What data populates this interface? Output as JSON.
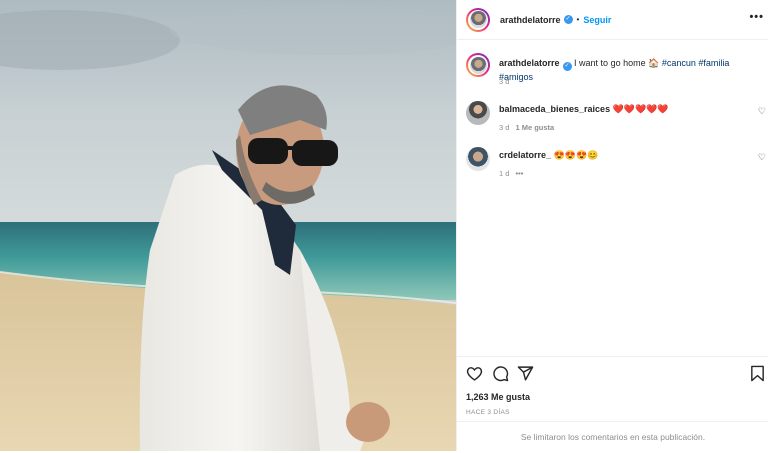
{
  "post": {
    "author": "arathdelatorre",
    "follow_label": "Seguir",
    "separator": "•",
    "more_label": "•••"
  },
  "caption": {
    "username": "arathdelatorre",
    "text": "I want to go home 🏠",
    "hashtags": [
      "#cancun",
      "#familia",
      "#amigos"
    ],
    "time": "3 d"
  },
  "comments": [
    {
      "username": "balmaceda_bienes_raices",
      "text": "❤️❤️❤️❤️❤️",
      "time": "3 d",
      "likes": "1 Me gusta"
    },
    {
      "username": "crdelatorre_",
      "text": "😍😍😍😊",
      "time": "1 d",
      "more": "•••"
    }
  ],
  "actions": {
    "icons": [
      "heart-icon",
      "comment-icon",
      "share-icon",
      "bookmark-icon"
    ],
    "likes": "1,263 Me gusta",
    "time_ago": "HACE 3 DÍAS",
    "comments_disabled": "Se limitaron los comentarios en esta publicación."
  },
  "colors": {
    "accent": "#0095f6",
    "verified": "#3897f0",
    "hashtag": "#00376b",
    "muted": "#8e8e8e"
  }
}
